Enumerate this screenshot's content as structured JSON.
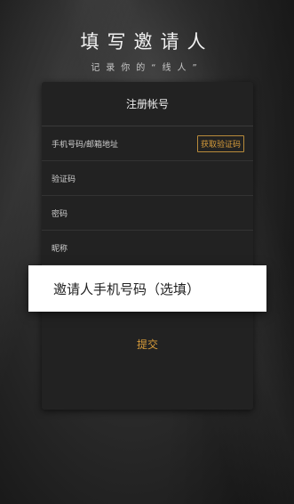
{
  "header": {
    "title": "填写邀请人",
    "subtitle": "记录你的“线人”"
  },
  "card": {
    "title": "注册帐号",
    "fields": [
      {
        "label": "手机号码/邮箱地址",
        "action": "获取验证码"
      },
      {
        "label": "验证码"
      },
      {
        "label": "密码"
      },
      {
        "label": "昵称"
      }
    ],
    "invite_field": "邀请人手机号码（选填）",
    "submit_label": "提交"
  },
  "colors": {
    "accent": "#d69b3a",
    "card_bg": "#222222",
    "popup_bg": "#ffffff"
  }
}
